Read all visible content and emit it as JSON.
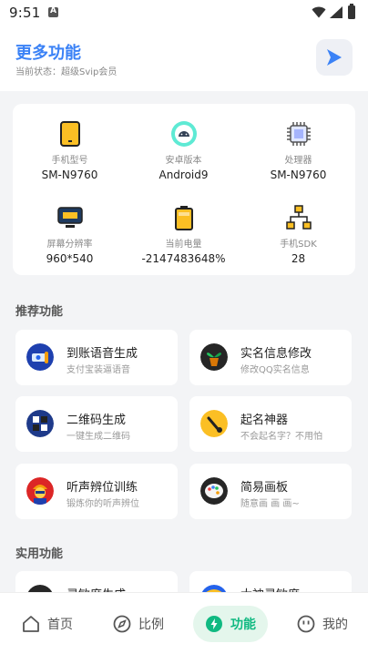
{
  "status_bar": {
    "time": "9:51"
  },
  "header": {
    "title": "更多功能",
    "subtitle": "当前状态：超级Svip会员"
  },
  "device_info": [
    {
      "label": "手机型号",
      "value": "SM-N9760",
      "icon": "phone-icon"
    },
    {
      "label": "安卓版本",
      "value": "Android9",
      "icon": "android-icon"
    },
    {
      "label": "处理器",
      "value": "SM-N9760",
      "icon": "cpu-icon"
    },
    {
      "label": "屏幕分辨率",
      "value": "960*540",
      "icon": "screen-icon"
    },
    {
      "label": "当前电量",
      "value": "-2147483648%",
      "icon": "battery-icon"
    },
    {
      "label": "手机SDK",
      "value": "28",
      "icon": "sdk-icon"
    }
  ],
  "sections": {
    "recommended": "推荐功能",
    "practical": "实用功能"
  },
  "features": [
    {
      "name": "到账语音生成",
      "desc": "支付宝装逼语音",
      "icon": "voice-money-icon"
    },
    {
      "name": "实名信息修改",
      "desc": "修改QQ实名信息",
      "icon": "plant-icon"
    },
    {
      "name": "二维码生成",
      "desc": "一键生成二维码",
      "icon": "qrcode-icon"
    },
    {
      "name": "起名神器",
      "desc": "不会起名字？不用怕",
      "icon": "brush-icon"
    },
    {
      "name": "听声辨位训练",
      "desc": "锻炼你的听声辨位",
      "icon": "soldier-icon"
    },
    {
      "name": "简易画板",
      "desc": "随意画 画 画~",
      "icon": "palette-icon"
    },
    {
      "name": "灵敏度生成",
      "desc": "",
      "icon": "sensitivity-icon"
    },
    {
      "name": "大神灵敏度",
      "desc": "",
      "icon": "master-icon"
    }
  ],
  "nav": [
    {
      "label": "首页",
      "icon": "home-icon"
    },
    {
      "label": "比例",
      "icon": "compass-icon"
    },
    {
      "label": "功能",
      "icon": "bolt-icon"
    },
    {
      "label": "我的",
      "icon": "smile-icon"
    }
  ],
  "colors": {
    "accent": "#3b82f6",
    "nav_active": "#10b981",
    "nav_active_bg": "#e4f6ec"
  }
}
